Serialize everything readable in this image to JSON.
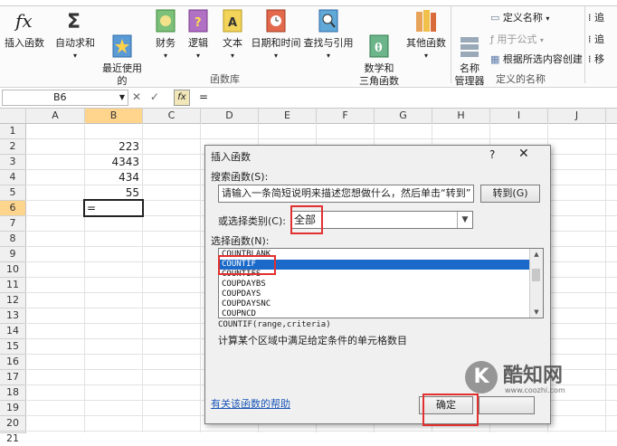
{
  "ribbon": {
    "insert_function": "插入函数",
    "autosum": "自动求和",
    "recent": "最近使用的\n函数",
    "financial": "财务",
    "logical": "逻辑",
    "text": "文本",
    "datetime": "日期和时间",
    "lookup": "查找与引用",
    "math": "数学和\n三角函数",
    "other": "其他函数",
    "name_manager": "名称\n管理器",
    "define_name": "定义名称",
    "use_in_formula": "用于公式",
    "create_from_selection": "根据所选内容创建",
    "group_library": "函数库",
    "group_names": "定义的名称",
    "cut_1": "追",
    "cut_2": "追",
    "cut_3": "移"
  },
  "formula_bar": {
    "name_box": "B6",
    "cancel": "✕",
    "enter": "✓",
    "fx": "fx",
    "value": "="
  },
  "sheet": {
    "columns": [
      "A",
      "B",
      "C",
      "D",
      "E",
      "F",
      "G",
      "H",
      "I",
      "J"
    ],
    "rows": [
      "1",
      "2",
      "3",
      "4",
      "5",
      "6",
      "7",
      "8",
      "9",
      "10",
      "11",
      "12",
      "13",
      "14",
      "15",
      "16",
      "17",
      "18",
      "19",
      "20",
      "21"
    ],
    "b2": "223",
    "b3": "4343",
    "b4": "434",
    "b5": "55",
    "b6": "="
  },
  "dialog": {
    "title": "插入函数",
    "help": "?",
    "close": "✕",
    "search_label": "搜索函数(S):",
    "search_value": "请输入一条简短说明来描述您想做什么，然后单击“转到”",
    "goto_button": "转到(G)",
    "category_label": "或选择类别(C):",
    "category_value": "全部",
    "function_label": "选择函数(N):",
    "functions": [
      "COUNTBLANK",
      "COUNTIF",
      "COUNTIFS",
      "COUPDAYBS",
      "COUPDAYS",
      "COUPDAYSNC",
      "COUPNCD"
    ],
    "selected_function": "COUNTIF",
    "signature": "COUNTIF(range,criteria)",
    "description": "计算某个区域中满足给定条件的单元格数目",
    "help_link": "有关该函数的帮助",
    "ok_button": "确定"
  },
  "watermark": {
    "logo": "K",
    "name": "酷知网",
    "url": "www.coozhi.com"
  },
  "colors": {
    "selection_blue": "#1b6ac9",
    "highlight_red": "#e23030",
    "header_selected": "#ffd58d"
  }
}
